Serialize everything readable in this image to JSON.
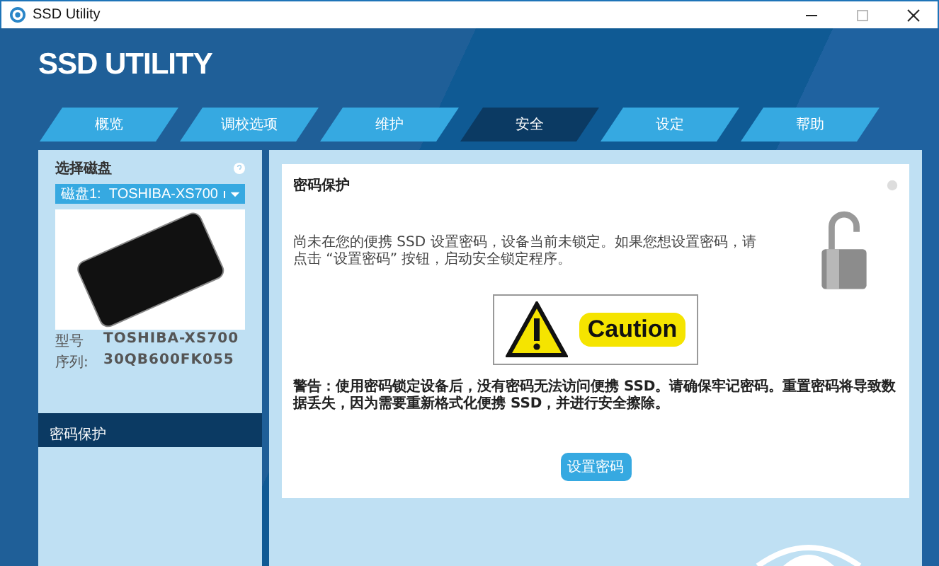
{
  "window": {
    "title": "SSD Utility"
  },
  "app_title": "SSD UTILITY",
  "tabs": [
    {
      "label": "概览",
      "selected": false
    },
    {
      "label": "调校选项",
      "selected": false
    },
    {
      "label": "维护",
      "selected": false
    },
    {
      "label": "安全",
      "selected": true
    },
    {
      "label": "设定",
      "selected": false
    },
    {
      "label": "帮助",
      "selected": false
    }
  ],
  "sidebar": {
    "heading": "选择磁盘",
    "drive_select": {
      "value": "磁盘1:  TOSHIBA-XS700"
    },
    "info": [
      {
        "label": "型号",
        "value": "TOSHIBA-XS700"
      },
      {
        "label": "序列:",
        "value": "30QB600FK055"
      }
    ],
    "items": [
      {
        "label": "密码保护",
        "selected": true
      }
    ]
  },
  "panel": {
    "title": "密码保护",
    "description": "尚未在您的便携 SSD 设置密码，设备当前未锁定。如果您想设置密码，请点击 “设置密码” 按钮，启动安全锁定程序。",
    "caution_label": "Caution",
    "warning": "警告：使用密码锁定设备后，没有密码无法访问便携 SSD。请确保牢记密码。重置密码将导致数据丢失，因为需要重新格式化便携 SSD，并进行安全擦除。",
    "button": "设置密码"
  }
}
